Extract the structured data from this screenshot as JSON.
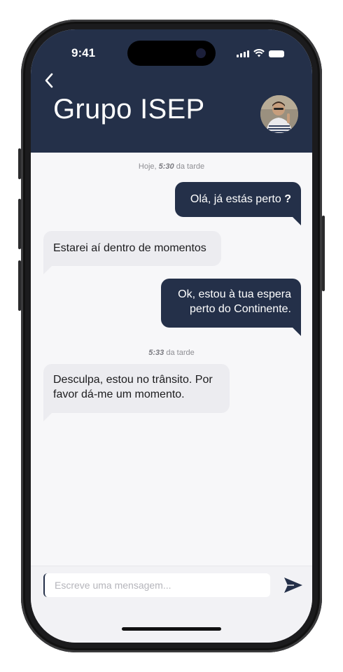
{
  "status_bar": {
    "time": "9:41",
    "icons": [
      "signal-icon",
      "wifi-icon",
      "battery-icon"
    ]
  },
  "header": {
    "back_icon": "chevron-left-icon",
    "title": "Grupo ISEP",
    "avatar": "avatar-photo"
  },
  "chat": {
    "timestamp_1": {
      "prefix": "Hoje, ",
      "time": "5:30",
      "suffix": " da tarde"
    },
    "messages": [
      {
        "direction": "out",
        "text": "Olá, já estás perto",
        "emphasis": "?"
      },
      {
        "direction": "in",
        "text": "Estarei aí dentro de momentos"
      },
      {
        "direction": "out",
        "line1": "Ok, estou à tua espera",
        "line2": "perto do Continente."
      },
      {
        "direction": "in",
        "line1": "Desculpa, estou no trânsito. Por",
        "line2": "favor dá-me um momento."
      }
    ],
    "timestamp_2": {
      "time": "5:33",
      "suffix": " da tarde"
    }
  },
  "composer": {
    "placeholder": "Escreve uma mensagem...",
    "value": "",
    "send_icon": "send-icon"
  },
  "colors": {
    "primary": "#243049",
    "incoming_bubble": "#ececf0",
    "background": "#f7f7f9"
  }
}
